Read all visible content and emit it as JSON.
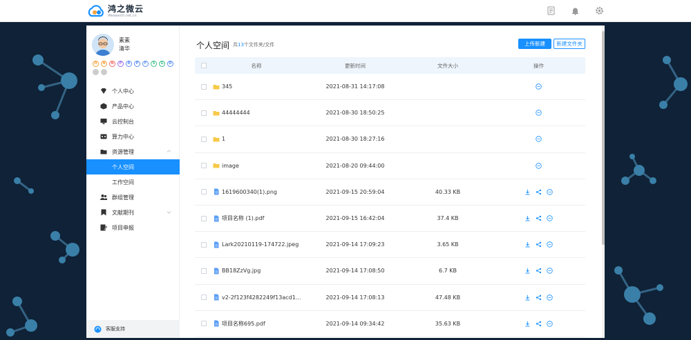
{
  "header": {
    "logo_title": "鸿之微云",
    "logo_sub": "iResearch.net.cn"
  },
  "colors": {
    "accent": "#1890ff",
    "folder": "#f7c948",
    "file": "#5b9ef5",
    "background": "#0f2237"
  },
  "user": {
    "name": "素素",
    "org": "清华"
  },
  "badges": [
    {
      "label": "O",
      "color": "#f2a13a"
    },
    {
      "label": "N",
      "color": "#f2a13a"
    },
    {
      "label": "N",
      "color": "#f26c6c"
    },
    {
      "label": "P",
      "color": "#9b6cf2"
    },
    {
      "label": "R",
      "color": "#5b8ef5"
    },
    {
      "label": "P",
      "color": "#5b8ef5"
    },
    {
      "label": "F",
      "color": "#5b8ef5"
    },
    {
      "label": "S",
      "color": "#3bbf8a"
    },
    {
      "label": "G",
      "color": "#3bbf8a"
    },
    {
      "label": "D",
      "color": "#5b8ef5"
    },
    {
      "label": "",
      "color": "#cccccc"
    },
    {
      "label": "",
      "color": "#cccccc"
    }
  ],
  "menu": {
    "personal_center": "个人中心",
    "product_center": "产品中心",
    "cloud_console": "云控制台",
    "compute_center": "算力中心",
    "resource_mgmt": "资源管理",
    "personal_space": "个人空间",
    "work_space": "工作空间",
    "group_mgmt": "群组管理",
    "literature": "文献期刊",
    "project_apply": "项目申报"
  },
  "support": "客服支持",
  "page": {
    "title": "个人空间",
    "count_prefix": "共",
    "count": "13",
    "count_suffix": "个文件夹/文件",
    "upload_button": "上传新建",
    "new_folder_button": "新建文件夹"
  },
  "table": {
    "columns": {
      "name": "名称",
      "time": "更新时间",
      "size": "文件大小",
      "action": "操作"
    },
    "rows": [
      {
        "type": "folder",
        "name": "345",
        "time": "2021-08-31 14:17:08",
        "size": ""
      },
      {
        "type": "folder",
        "name": "44444444",
        "time": "2021-08-30 18:50:25",
        "size": ""
      },
      {
        "type": "folder",
        "name": "1",
        "time": "2021-08-30 18:27:16",
        "size": ""
      },
      {
        "type": "folder",
        "name": "image",
        "time": "2021-08-20 09:44:00",
        "size": ""
      },
      {
        "type": "file",
        "name": "1619600340(1).png",
        "time": "2021-09-15 20:59:04",
        "size": "40.33 KB"
      },
      {
        "type": "file",
        "name": "项目名称 (1).pdf",
        "time": "2021-09-15 16:42:04",
        "size": "37.4 KB"
      },
      {
        "type": "file",
        "name": "Lark20210119-174722.jpeg",
        "time": "2021-09-14 17:09:23",
        "size": "3.65 KB"
      },
      {
        "type": "file",
        "name": "BB18ZzVg.jpg",
        "time": "2021-09-14 17:08:50",
        "size": "6.7 KB"
      },
      {
        "type": "file",
        "name": "v2-2f123f4282249f13acd1...",
        "time": "2021-09-14 17:08:13",
        "size": "47.48 KB"
      },
      {
        "type": "file",
        "name": "项目名称695.pdf",
        "time": "2021-09-14 09:34:42",
        "size": "35.63 KB"
      }
    ]
  }
}
